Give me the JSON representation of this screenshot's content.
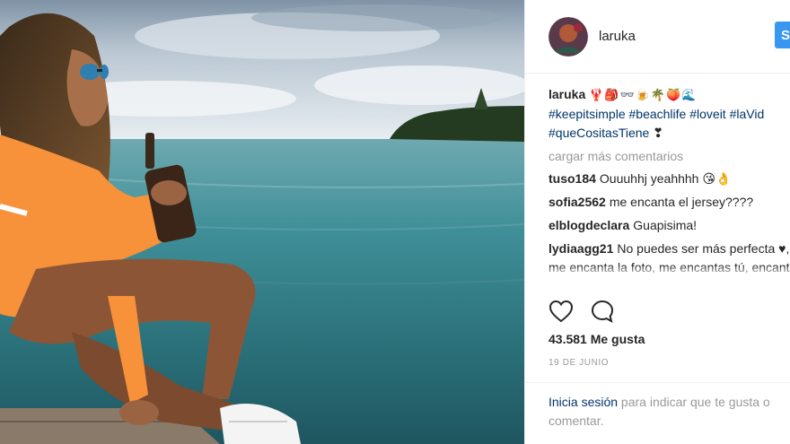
{
  "post": {
    "username": "laruka",
    "follow_label": "S"
  },
  "caption": {
    "username": "laruka",
    "emojis": "🦞🎒👓🍺🌴🍑🌊",
    "hashtags_line1": [
      "#keepitsimple",
      "#beachlife",
      "#loveit",
      "#laVid"
    ],
    "hashtags_line2_tag": "#queCositasTiene",
    "hashtags_line2_tail": "❣"
  },
  "load_more": "cargar más comentarios",
  "comments": [
    {
      "user": "tuso184",
      "text": "Ouuuhhj yeahhhh 😘👌"
    },
    {
      "user": "sofia2562",
      "text": "me encanta el jersey????"
    },
    {
      "user": "elblogdeclara",
      "text": "Guapisima!"
    },
    {
      "user": "lydiaagg21",
      "text": "No puedes ser más perfecta ♥, me encanta la foto, me encantas tú, encanta tu ropa, me encanta el paisaje"
    }
  ],
  "likes": "43.581 Me gusta",
  "date": "19 DE JUNIO",
  "login": {
    "link": "Inicia sesión",
    "rest": " para indicar que te gusta o comentar."
  },
  "colors": {
    "follow_button": "#3897f0",
    "hashtag": "#003569",
    "muted": "#999999"
  },
  "icons": [
    "heart-icon",
    "comment-icon"
  ]
}
